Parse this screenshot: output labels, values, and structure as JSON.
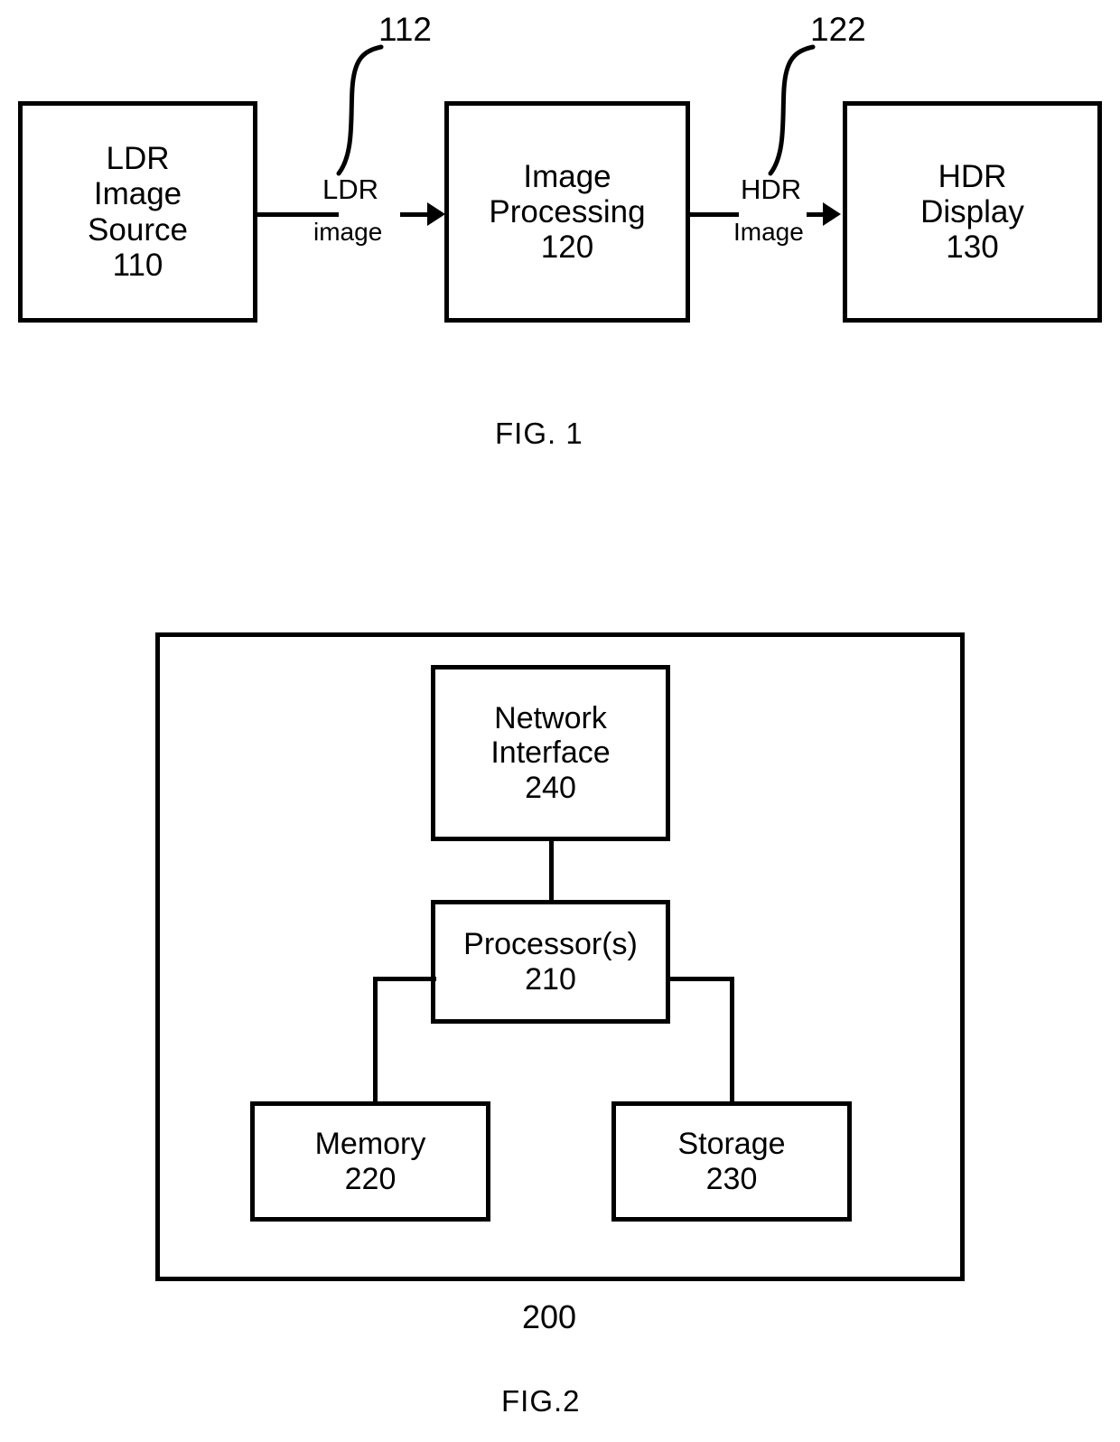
{
  "figure1": {
    "caption": "FIG. 1",
    "blocks": [
      {
        "id": "ldr-image-source",
        "lines": [
          "LDR",
          "Image",
          "Source",
          "110"
        ]
      },
      {
        "id": "image-processing",
        "lines": [
          "Image",
          "Processing",
          "120"
        ]
      },
      {
        "id": "hdr-display",
        "lines": [
          "HDR",
          "Display",
          "130"
        ]
      }
    ],
    "edges": [
      {
        "id": "ldr-image-edge",
        "label_top": "LDR",
        "label_bottom": "image",
        "ref": "112"
      },
      {
        "id": "hdr-image-edge",
        "label_top": "HDR",
        "label_bottom": "Image",
        "ref": "122"
      }
    ]
  },
  "figure2": {
    "caption": "FIG.2",
    "system_ref": "200",
    "blocks": [
      {
        "id": "network-interface",
        "lines": [
          "Network",
          "Interface",
          "240"
        ]
      },
      {
        "id": "processors",
        "lines": [
          "Processor(s)",
          "210"
        ]
      },
      {
        "id": "memory",
        "lines": [
          "Memory",
          "220"
        ]
      },
      {
        "id": "storage",
        "lines": [
          "Storage",
          "230"
        ]
      }
    ]
  },
  "colors": {
    "ink": "#000000",
    "paper": "#ffffff"
  }
}
